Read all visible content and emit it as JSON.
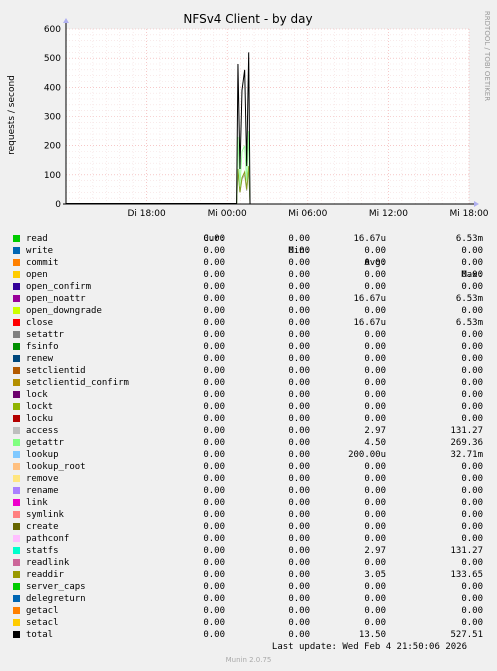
{
  "chart_data": {
    "type": "line",
    "title": "NFSv4 Client - by day",
    "ylabel": "requests / second",
    "side_label": "RRDTOOL / TOBI OETIKER",
    "ylim": [
      0,
      600
    ],
    "yticks": [
      0,
      100,
      200,
      300,
      400,
      500,
      600
    ],
    "xrange": [
      0,
      30
    ],
    "xticks": [
      {
        "label": "Di 18:00",
        "x": 6
      },
      {
        "label": "Mi 00:00",
        "x": 12
      },
      {
        "label": "Mi 06:00",
        "x": 18
      },
      {
        "label": "Mi 12:00",
        "x": 24
      },
      {
        "label": "Mi 18:00",
        "x": 30
      }
    ],
    "grid": true,
    "series": [
      {
        "name": "total",
        "color": "#000000",
        "points": [
          [
            12.7,
            0
          ],
          [
            12.8,
            480
          ],
          [
            12.95,
            120
          ],
          [
            13.1,
            390
          ],
          [
            13.3,
            460
          ],
          [
            13.45,
            130
          ],
          [
            13.6,
            520
          ],
          [
            13.7,
            0
          ]
        ]
      },
      {
        "name": "getattr",
        "color": "#99ff99",
        "points": [
          [
            12.7,
            0
          ],
          [
            12.8,
            230
          ],
          [
            12.95,
            60
          ],
          [
            13.1,
            180
          ],
          [
            13.3,
            200
          ],
          [
            13.45,
            80
          ],
          [
            13.6,
            250
          ],
          [
            13.7,
            0
          ]
        ]
      },
      {
        "name": "readdir",
        "color": "#85a01e",
        "points": [
          [
            12.7,
            0
          ],
          [
            12.8,
            120
          ],
          [
            12.95,
            40
          ],
          [
            13.1,
            90
          ],
          [
            13.3,
            110
          ],
          [
            13.45,
            50
          ],
          [
            13.6,
            130
          ],
          [
            13.7,
            0
          ]
        ]
      },
      {
        "name": "access",
        "color": "#b3b3b3",
        "points": [
          [
            12.7,
            0
          ],
          [
            12.8,
            110
          ],
          [
            12.95,
            40
          ],
          [
            13.1,
            85
          ],
          [
            13.3,
            100
          ],
          [
            13.45,
            45
          ],
          [
            13.6,
            120
          ],
          [
            13.7,
            0
          ]
        ]
      }
    ]
  },
  "legend": {
    "headers": {
      "cur": "Cur:",
      "min": "Min:",
      "avg": "Avg:",
      "max": "Max:"
    },
    "rows": [
      {
        "name": "read",
        "color": "#00cc00",
        "cur": "0.00",
        "min": "0.00",
        "avg": "16.67u",
        "max": "6.53m"
      },
      {
        "name": "write",
        "color": "#0066b3",
        "cur": "0.00",
        "min": "0.00",
        "avg": "0.00",
        "max": "0.00"
      },
      {
        "name": "commit",
        "color": "#ff8000",
        "cur": "0.00",
        "min": "0.00",
        "avg": "0.00",
        "max": "0.00"
      },
      {
        "name": "open",
        "color": "#ffcc00",
        "cur": "0.00",
        "min": "0.00",
        "avg": "0.00",
        "max": "0.00"
      },
      {
        "name": "open_confirm",
        "color": "#330099",
        "cur": "0.00",
        "min": "0.00",
        "avg": "0.00",
        "max": "0.00"
      },
      {
        "name": "open_noattr",
        "color": "#990099",
        "cur": "0.00",
        "min": "0.00",
        "avg": "16.67u",
        "max": "6.53m"
      },
      {
        "name": "open_downgrade",
        "color": "#ccff00",
        "cur": "0.00",
        "min": "0.00",
        "avg": "0.00",
        "max": "0.00"
      },
      {
        "name": "close",
        "color": "#ff0000",
        "cur": "0.00",
        "min": "0.00",
        "avg": "16.67u",
        "max": "6.53m"
      },
      {
        "name": "setattr",
        "color": "#808080",
        "cur": "0.00",
        "min": "0.00",
        "avg": "0.00",
        "max": "0.00"
      },
      {
        "name": "fsinfo",
        "color": "#008f00",
        "cur": "0.00",
        "min": "0.00",
        "avg": "0.00",
        "max": "0.00"
      },
      {
        "name": "renew",
        "color": "#00487d",
        "cur": "0.00",
        "min": "0.00",
        "avg": "0.00",
        "max": "0.00"
      },
      {
        "name": "setclientid",
        "color": "#b35a00",
        "cur": "0.00",
        "min": "0.00",
        "avg": "0.00",
        "max": "0.00"
      },
      {
        "name": "setclientid_confirm",
        "color": "#b38f00",
        "cur": "0.00",
        "min": "0.00",
        "avg": "0.00",
        "max": "0.00"
      },
      {
        "name": "lock",
        "color": "#6b006b",
        "cur": "0.00",
        "min": "0.00",
        "avg": "0.00",
        "max": "0.00"
      },
      {
        "name": "lockt",
        "color": "#8fb300",
        "cur": "0.00",
        "min": "0.00",
        "avg": "0.00",
        "max": "0.00"
      },
      {
        "name": "locku",
        "color": "#b30000",
        "cur": "0.00",
        "min": "0.00",
        "avg": "0.00",
        "max": "0.00"
      },
      {
        "name": "access",
        "color": "#bebebe",
        "cur": "0.00",
        "min": "0.00",
        "avg": "2.97",
        "max": "131.27"
      },
      {
        "name": "getattr",
        "color": "#80ff80",
        "cur": "0.00",
        "min": "0.00",
        "avg": "4.50",
        "max": "269.36"
      },
      {
        "name": "lookup",
        "color": "#80c9ff",
        "cur": "0.00",
        "min": "0.00",
        "avg": "200.00u",
        "max": "32.71m"
      },
      {
        "name": "lookup_root",
        "color": "#ffc080",
        "cur": "0.00",
        "min": "0.00",
        "avg": "0.00",
        "max": "0.00"
      },
      {
        "name": "remove",
        "color": "#ffe680",
        "cur": "0.00",
        "min": "0.00",
        "avg": "0.00",
        "max": "0.00"
      },
      {
        "name": "rename",
        "color": "#aa80ff",
        "cur": "0.00",
        "min": "0.00",
        "avg": "0.00",
        "max": "0.00"
      },
      {
        "name": "link",
        "color": "#ee00cc",
        "cur": "0.00",
        "min": "0.00",
        "avg": "0.00",
        "max": "0.00"
      },
      {
        "name": "symlink",
        "color": "#ff8080",
        "cur": "0.00",
        "min": "0.00",
        "avg": "0.00",
        "max": "0.00"
      },
      {
        "name": "create",
        "color": "#666600",
        "cur": "0.00",
        "min": "0.00",
        "avg": "0.00",
        "max": "0.00"
      },
      {
        "name": "pathconf",
        "color": "#ffbfff",
        "cur": "0.00",
        "min": "0.00",
        "avg": "0.00",
        "max": "0.00"
      },
      {
        "name": "statfs",
        "color": "#00ffcc",
        "cur": "0.00",
        "min": "0.00",
        "avg": "2.97",
        "max": "131.27"
      },
      {
        "name": "readlink",
        "color": "#cc6699",
        "cur": "0.00",
        "min": "0.00",
        "avg": "0.00",
        "max": "0.00"
      },
      {
        "name": "readdir",
        "color": "#999900",
        "cur": "0.00",
        "min": "0.00",
        "avg": "3.05",
        "max": "133.65"
      },
      {
        "name": "server_caps",
        "color": "#00cc00",
        "cur": "0.00",
        "min": "0.00",
        "avg": "0.00",
        "max": "0.00"
      },
      {
        "name": "delegreturn",
        "color": "#0066b3",
        "cur": "0.00",
        "min": "0.00",
        "avg": "0.00",
        "max": "0.00"
      },
      {
        "name": "getacl",
        "color": "#ff8000",
        "cur": "0.00",
        "min": "0.00",
        "avg": "0.00",
        "max": "0.00"
      },
      {
        "name": "setacl",
        "color": "#ffcc00",
        "cur": "0.00",
        "min": "0.00",
        "avg": "0.00",
        "max": "0.00"
      },
      {
        "name": "total",
        "color": "#000000",
        "cur": "0.00",
        "min": "0.00",
        "avg": "13.50",
        "max": "527.51"
      }
    ]
  },
  "footer": {
    "last_update": "Last update: Wed Feb  4 21:50:06 2026",
    "munin": "Munin 2.0.75"
  }
}
